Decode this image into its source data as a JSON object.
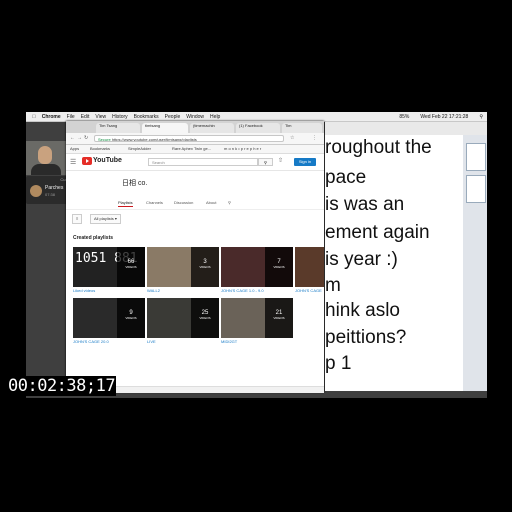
{
  "menubar": {
    "apple": "",
    "items": [
      "Chrome",
      "File",
      "Edit",
      "View",
      "History",
      "Bookmarks",
      "People",
      "Window",
      "Help"
    ],
    "clock": "Wed Feb 22  17:21:28",
    "battery": "85%"
  },
  "call": {
    "header": "Current Call",
    "name": "Parches",
    "duration": "07:38"
  },
  "browser": {
    "tabs": [
      "Tim Tsang",
      "timtsang",
      "(timemachin",
      "(1) Facebook",
      "Tim"
    ],
    "url_secure": "Secure",
    "url": "https://www.youtube.com/user/timtsang/playlists",
    "bookmarks": [
      "Apps",
      "Bookmarks",
      "SimpleAdder",
      "Rare Aphex Twin ge...",
      "m o n k • p r e p h e r"
    ]
  },
  "youtube": {
    "logo_text": "YouTube",
    "search_placeholder": "Search",
    "signin": "Sign in",
    "channel_name": "日相 co.",
    "channel_tabs": [
      "Playlists",
      "Channels",
      "Discussion",
      "About"
    ],
    "filter_label": "All playlists",
    "section_title": "Created playlists",
    "playlists": [
      {
        "title": "Liked videos",
        "count": "66",
        "unit": "VIDEOS",
        "color": "#111"
      },
      {
        "title": "WALL2",
        "count": "3",
        "unit": "VIDEOS",
        "color": "#8a7a66"
      },
      {
        "title": "JOHN'S CAGE 1.0 - 9.0",
        "count": "7",
        "unit": "VIDEOS",
        "color": "#4a2a2a"
      },
      {
        "title": "JOHN'S CAGE",
        "count": "",
        "unit": "",
        "color": "#5a3a2a"
      },
      {
        "title": "JOHN'S CAGE 20.0",
        "count": "9",
        "unit": "VIDEOS",
        "color": "#2a2a2a"
      },
      {
        "title": "LIVE",
        "count": "25",
        "unit": "VIDEOS",
        "color": "#3a3a36"
      },
      {
        "title": "MIDI2GT",
        "count": "21",
        "unit": "VIDEOS",
        "color": "#6a6258"
      }
    ],
    "liked_overlay": "1051 881"
  },
  "document": {
    "lines": [
      "roughout the",
      "pace",
      "is was an",
      "ement again",
      "is year :)",
      "m",
      "hink aslo",
      "peittions?",
      "p 1"
    ]
  },
  "timecode": "00:02:38;17"
}
